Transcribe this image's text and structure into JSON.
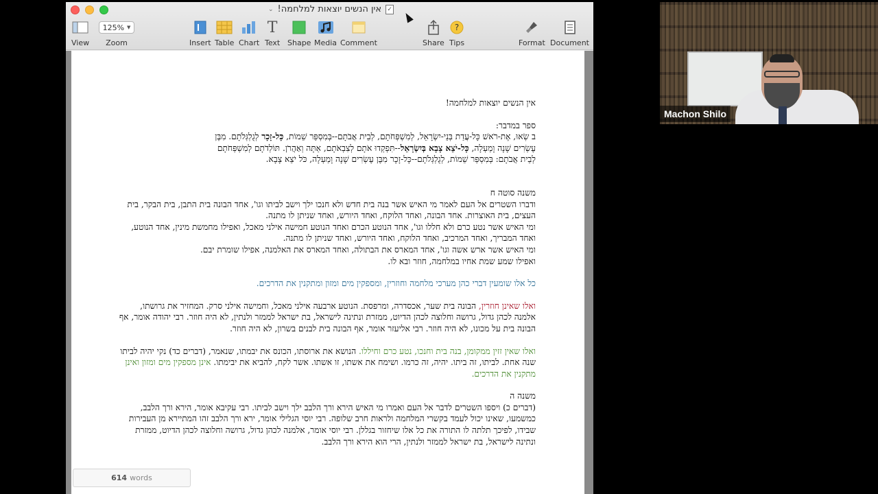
{
  "window": {
    "title": "אין הנשים יוצאות למלחמה!"
  },
  "toolbar": {
    "zoom_value": "125%",
    "items": {
      "view": "View",
      "zoom": "Zoom",
      "insert": "Insert",
      "table": "Table",
      "chart": "Chart",
      "text": "Text",
      "shape": "Shape",
      "media": "Media",
      "comment": "Comment",
      "share": "Share",
      "tips": "Tips",
      "format": "Format",
      "document": "Document"
    }
  },
  "document": {
    "heading": "אין הנשים יוצאות למלחמה!",
    "bamidbar_title": "ספר במדבר:",
    "bamidbar_l1_a": "ב שְׂאוּ, אֶת-רֹאשׁ כָּל-עֲדַת בְּנֵי-יִשְׂרָאֵל, לְמִשְׁפְּחֹתָם, לְבֵית אֲבֹתָם--בְּמִסְפַּר שֵׁמוֹת, ",
    "bamidbar_l1_b": "כָּל-זָכָר",
    "bamidbar_l1_c": " לְגֻלְגְּלֹתָם. מִבֶּן",
    "bamidbar_l2_a": "עֶשְׂרִים שָׁנָה וָמַעְלָה, ",
    "bamidbar_l2_b": "כָּל-יֹצֵא צָבָא בְּיִשְׂרָאֵל",
    "bamidbar_l2_c": "--תִּפְקְדוּ אֹתָם לְצִבְאֹתָם, אַתָּה וְאַהֲרֹן. תּוֹלְדֹתָם לְמִשְׁפְּחֹתָם",
    "bamidbar_l3": "לְבֵית אֲבֹתָם:  בְּמִסְפַּר שֵׁמוֹת, לְגֻלְגְּלֹתָם--כָּל-זָכָר מִבֶּן עֶשְׂרִים שָׁנָה וָמַעְלָה, כֹּל יֹצֵא צָבָא.",
    "sotah8_title": "משנה סוטה ח",
    "sotah8_p1": "ודברו השטרים אל העם לאמר מי האיש אשר בנה בית חדש ולא חנכו ילך וישב לביתו וגו', אחד הבונה בית התבן, בית הבקר, בית העצים, בית האוצרות. אחד הבונה, ואחד הלוקח, ואחד היורש, ואחד שניתן לו מתנה.",
    "sotah8_p2": "ומי האיש אשר נטע כרם ולא חללו וגו', אחד הנוטע הכרם ואחד הנוטע חמישה אילני מאכל, ואפילו מחמשת מינין, אחד הנוטע, ואחד המבריך, ואחד המרכיב, ואחד הלוקח, ואחד היורש, ואחד שניתן לו מתנה.",
    "sotah8_p3": "ומי האיש אשר ארש אשה וגו', אחד המארס את הבתולה, ואחד המארס את האלמנה, אפילו שומרת יבם.",
    "sotah8_p4": "ואפילו שמע שמת אחיו במלחמה, חוזר ובא לו.",
    "blue_line": "כל אלו שומעין דברי כהן מערכי מלחמה וחוזרין, ומספקין מים ומזון ומתקנין את הדרכים.",
    "red_lead": "ואלו שאינן חוזרין,",
    "red_rest": " הבונה בית שער, אכסדרה, ומרפסת. הנוטע ארבעה אילני מאכל, וחמישה אילני סרק. המחזיר את גרושתו, אלמנה לכהן גדול, גרושה וחלוצה לכהן הדיוט, ממזרת ונתינה לישראל, בת ישראל לממזר ולנתין, לא היה חוזר. רבי יהודה אומר, אף הבונה בית על מכונו, לא היה חוזר. רבי אליעזר אומר, אף הבונה בית לבנים בשרון, לא היה חוזר.",
    "green_lead": "ואלו שאין זזין ממקומן, בנה בית וחנכו, נטע כרם וחיללו.",
    "green_mid": " הנושא את ארוסתו, הכונס את יבמתו, שנאמר, (דברים כד) נקי יהיה לביתו שנה אחת. לביתו, זה ביתו. יהיה, זה כרמו. ושימח את אשתו, זו אשתו. אשר לקח, להביא את יבימתו. ",
    "green_tail": "אינן מספקין מים ומזון ואינן מתקנין את הדרכים.",
    "mishna5_title": "משנה ה",
    "mishna5_p": "(דברים כ) ויספו השטרים לדבר אל העם ואמרו מי האיש הירא ורך הלבב ילך וישב לביתו. רבי עקיבא אומר, הירא ורך הלבב, כמשמעו, שאינו יכול לעמד בקשרי המלחמה ולראות חרב שלופה. רבי יוסי הגלילי אומר, ירא ורך הלבב זהו המתיירא מן העבירות שבידו, לפיכך תלתה לו התורה את כל אלו שיחזור בגללן. רבי יוסי אומר, אלמנה לכהן גדול, גרושה וחלוצה לכהן הדיוט, ממזרת ונתינה לישראל, בת ישראל לממזר ולנתין, הרי הוא הירא ורך הלבב."
  },
  "status": {
    "word_count": "614",
    "word_label": "words"
  },
  "video": {
    "participant_name": "Machon Shilo"
  }
}
